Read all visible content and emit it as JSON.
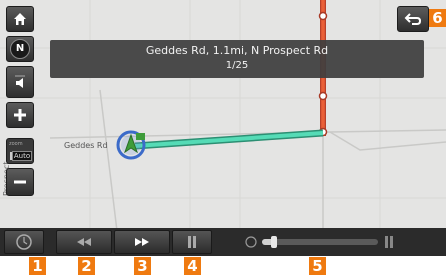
{
  "guidance": {
    "route_text": "Geddes Rd, 1.1mi, N Prospect Rd",
    "step_text": "1/25"
  },
  "map": {
    "road_label": "Geddes Rd",
    "vertical_label": "Prospect",
    "compass_label": "N",
    "zoom_mode_small": "zoom",
    "zoom_mode_label": "Auto",
    "route_color": "#4fd6b0",
    "highlight_road_color": "#e8572f"
  },
  "sidebar_icons": [
    "home-icon",
    "compass-icon",
    "volume-icon",
    "zoom-in-icon",
    "auto-zoom-icon",
    "zoom-out-icon"
  ],
  "bottom_controls": {
    "icons": [
      "clock-icon",
      "rewind-icon",
      "fast-forward-icon",
      "pause-icon",
      "speed-slider"
    ],
    "simulation_progress": 0.1
  },
  "callouts": {
    "b1": "1",
    "b2": "2",
    "b3": "3",
    "b4": "4",
    "b5": "5",
    "b6": "6"
  },
  "colors": {
    "callout": "#ef7a10"
  }
}
